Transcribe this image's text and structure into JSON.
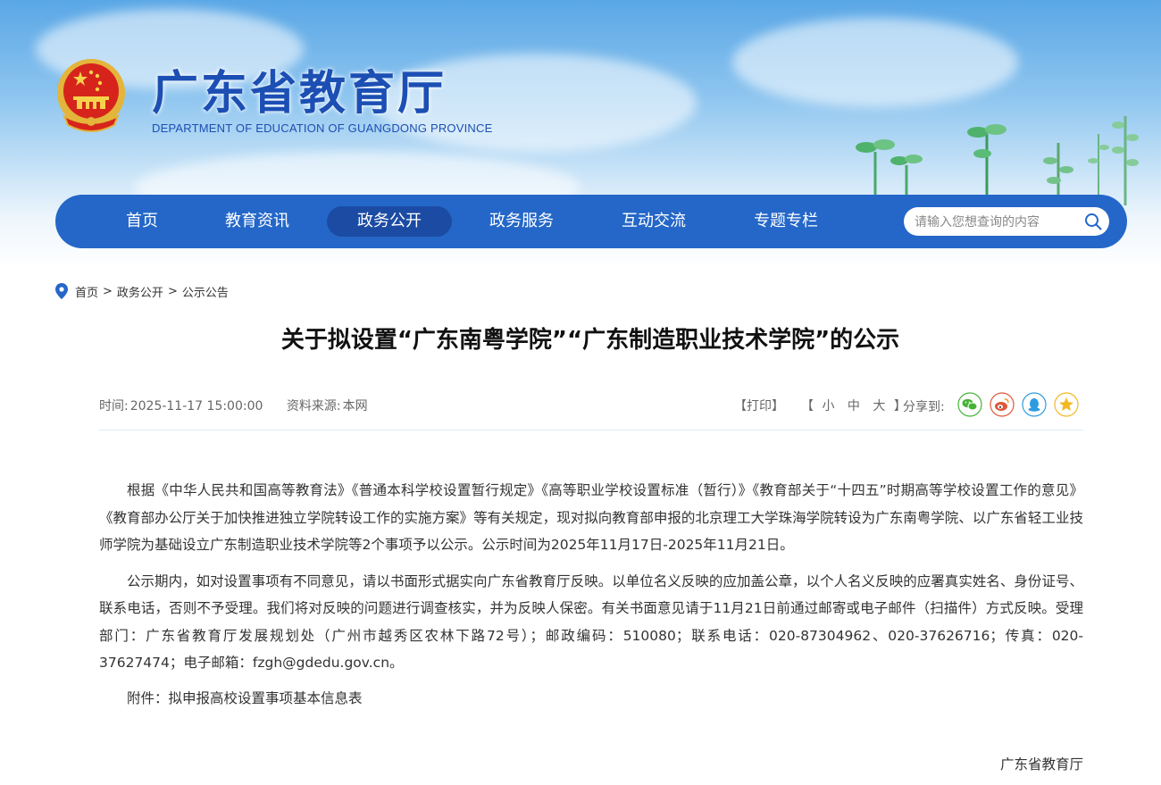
{
  "site": {
    "title": "广东省教育厅",
    "subtitle": "DEPARTMENT OF EDUCATION OF GUANGDONG PROVINCE"
  },
  "nav": {
    "items": [
      {
        "label": "首页"
      },
      {
        "label": "教育资讯"
      },
      {
        "label": "政务公开",
        "active": true
      },
      {
        "label": "政务服务"
      },
      {
        "label": "互动交流"
      },
      {
        "label": "专题专栏"
      }
    ],
    "search_placeholder": "请输入您想查询的内容"
  },
  "breadcrumb": {
    "items": [
      "首页",
      "政务公开",
      "公示公告"
    ],
    "separator": ">"
  },
  "article": {
    "title": "关于拟设置“广东南粤学院”“广东制造职业技术学院”的公示",
    "time_label": "时间:",
    "time": "2025-11-17 15:00:00",
    "source_label": "资料来源:",
    "source": "本网",
    "print_label": "【打印】",
    "font_size": {
      "open": "【",
      "small": "小",
      "medium": "中",
      "large": "大",
      "close": "】"
    },
    "share_label": "分享到:",
    "share_icons": [
      "wechat-icon",
      "weibo-icon",
      "qq-icon",
      "qzone-icon"
    ],
    "paragraphs": [
      "根据《中华人民共和国高等教育法》《普通本科学校设置暂行规定》《高等职业学校设置标准（暂行）》《教育部关于“十四五”时期高等学校设置工作的意见》《教育部办公厅关于加快推进独立学院转设工作的实施方案》等有关规定，现对拟向教育部申报的北京理工大学珠海学院转设为广东南粤学院、以广东省轻工业技师学院为基础设立广东制造职业技术学院等2个事项予以公示。公示时间为2025年11月17日-2025年11月21日。",
      "公示期内，如对设置事项有不同意见，请以书面形式据实向广东省教育厅反映。以单位名义反映的应加盖公章，以个人名义反映的应署真实姓名、身份证号、联系电话，否则不予受理。我们将对反映的问题进行调查核实，并为反映人保密。有关书面意见请于11月21日前通过邮寄或电子邮件（扫描件）方式反映。受理部门：广东省教育厅发展规划处（广州市越秀区农林下路72号）；邮政编码：510080；联系电话：020-87304962、020-37626716；传真：020-37627474；电子邮箱：fzgh@gdedu.gov.cn。"
    ],
    "attachment_label": "附件：",
    "attachment": "拟申报高校设置事项基本信息表",
    "signer": "广东省教育厅"
  },
  "colors": {
    "nav_bg": "#2467c8",
    "nav_active": "#1b4ba3",
    "title_blue": "#1c4fb4"
  }
}
